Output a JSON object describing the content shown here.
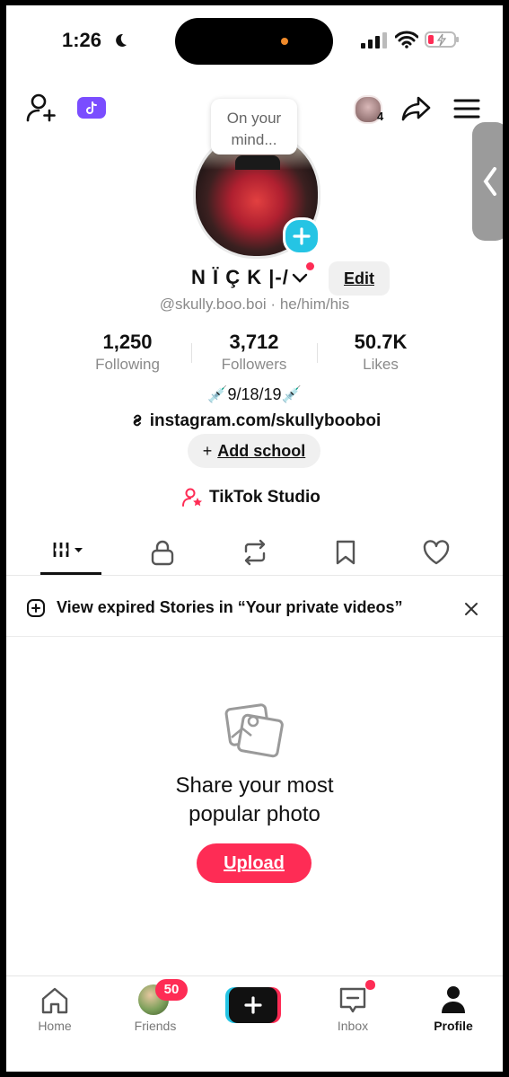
{
  "status_bar": {
    "time": "1:26"
  },
  "header": {
    "share_count_badge": "4"
  },
  "profile": {
    "thought_bubble": "On your mind...",
    "display_name": "N Ï Ç K |-/",
    "edit_label": "Edit",
    "username": "@skully.boo.boi",
    "pronouns": "he/him/his",
    "separator": "·",
    "bio_date": "9/18/19",
    "bio_link": "instagram.com/skullybooboi",
    "add_school_label": "Add school",
    "add_school_plus": "+",
    "studio_label": "TikTok Studio"
  },
  "stats": [
    {
      "value": "1,250",
      "label": "Following"
    },
    {
      "value": "3,712",
      "label": "Followers"
    },
    {
      "value": "50.7K",
      "label": "Likes"
    }
  ],
  "tabs": [
    "videos-grid",
    "private",
    "reposts",
    "favorites",
    "liked"
  ],
  "notice": {
    "text": "View expired Stories in “Your private videos”"
  },
  "empty_state": {
    "line1": "Share your most",
    "line2": "popular photo",
    "button_label": "Upload"
  },
  "bottom_nav": {
    "home": "Home",
    "friends": "Friends",
    "friends_badge": "50",
    "inbox": "Inbox",
    "profile": "Profile"
  },
  "colors": {
    "accent": "#fe2c55",
    "teal": "#25c4e4",
    "tiktok_purple": "#7a4dff"
  }
}
